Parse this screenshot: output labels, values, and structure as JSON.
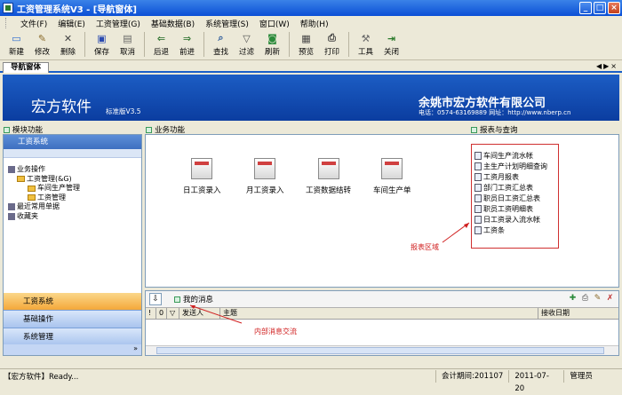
{
  "window": {
    "title": "工资管理系统V3 - [导航窗体]"
  },
  "menu": [
    "文件(F)",
    "编辑(E)",
    "工资管理(G)",
    "基础数据(B)",
    "系统管理(S)",
    "窗口(W)",
    "帮助(H)"
  ],
  "toolbar": [
    {
      "label": "新建",
      "icon": "new-doc-icon"
    },
    {
      "label": "修改",
      "icon": "edit-icon"
    },
    {
      "label": "删除",
      "icon": "delete-icon"
    },
    {
      "label": "保存",
      "icon": "save-icon"
    },
    {
      "label": "取消",
      "icon": "cancel-icon"
    },
    {
      "label": "后退",
      "icon": "back-arrow-icon"
    },
    {
      "label": "前进",
      "icon": "forward-arrow-icon"
    },
    {
      "label": "查找",
      "icon": "search-icon"
    },
    {
      "label": "过滤",
      "icon": "filter-icon"
    },
    {
      "label": "刷新",
      "icon": "refresh-icon"
    },
    {
      "label": "预览",
      "icon": "preview-icon"
    },
    {
      "label": "打印",
      "icon": "print-icon"
    },
    {
      "label": "工具",
      "icon": "tools-icon"
    },
    {
      "label": "关闭",
      "icon": "exit-icon"
    }
  ],
  "tab": {
    "label": "导航窗体"
  },
  "banner": {
    "brand": "宏方软件",
    "version": "标准版V3.5",
    "company": "余姚市宏方软件有限公司",
    "contact": "电话：0574-63169889      网址：http://www.nberp.cn"
  },
  "left_panel": {
    "title": "模块功能",
    "header": "工资系统",
    "tree": [
      "业务操作",
      "工资管理(&G)",
      "车间生产管理",
      "工资管理",
      "最近常用单据",
      "收藏夹"
    ],
    "nav": [
      "工资系统",
      "基础操作",
      "系统管理"
    ]
  },
  "business": {
    "title": "业务功能",
    "items": [
      "日工资录入",
      "月工资录入",
      "工资数据结转",
      "车间生产单"
    ]
  },
  "reports": {
    "title": "报表与查询",
    "items": [
      "车间生产流水帐",
      "主生产计划明细查询",
      "工资月报表",
      "部门工资汇总表",
      "职员日工资汇总表",
      "职员工资明细表",
      "日工资录入流水帐",
      "工资条"
    ],
    "annotation": "报表区域"
  },
  "messages": {
    "title": "我的消息",
    "annotation": "内部消息交流",
    "columns": [
      "!",
      "0",
      "▽",
      "发送人",
      "主题",
      "接收日期"
    ]
  },
  "status": {
    "left": "【宏方软件】Ready...",
    "period": "会计期间:201107",
    "date": "2011-07-20",
    "user": "管理员"
  },
  "colors": {
    "title_blue": "#0b4fd6",
    "banner_blue": "#1c5dc4",
    "accent_red": "#d03030"
  }
}
